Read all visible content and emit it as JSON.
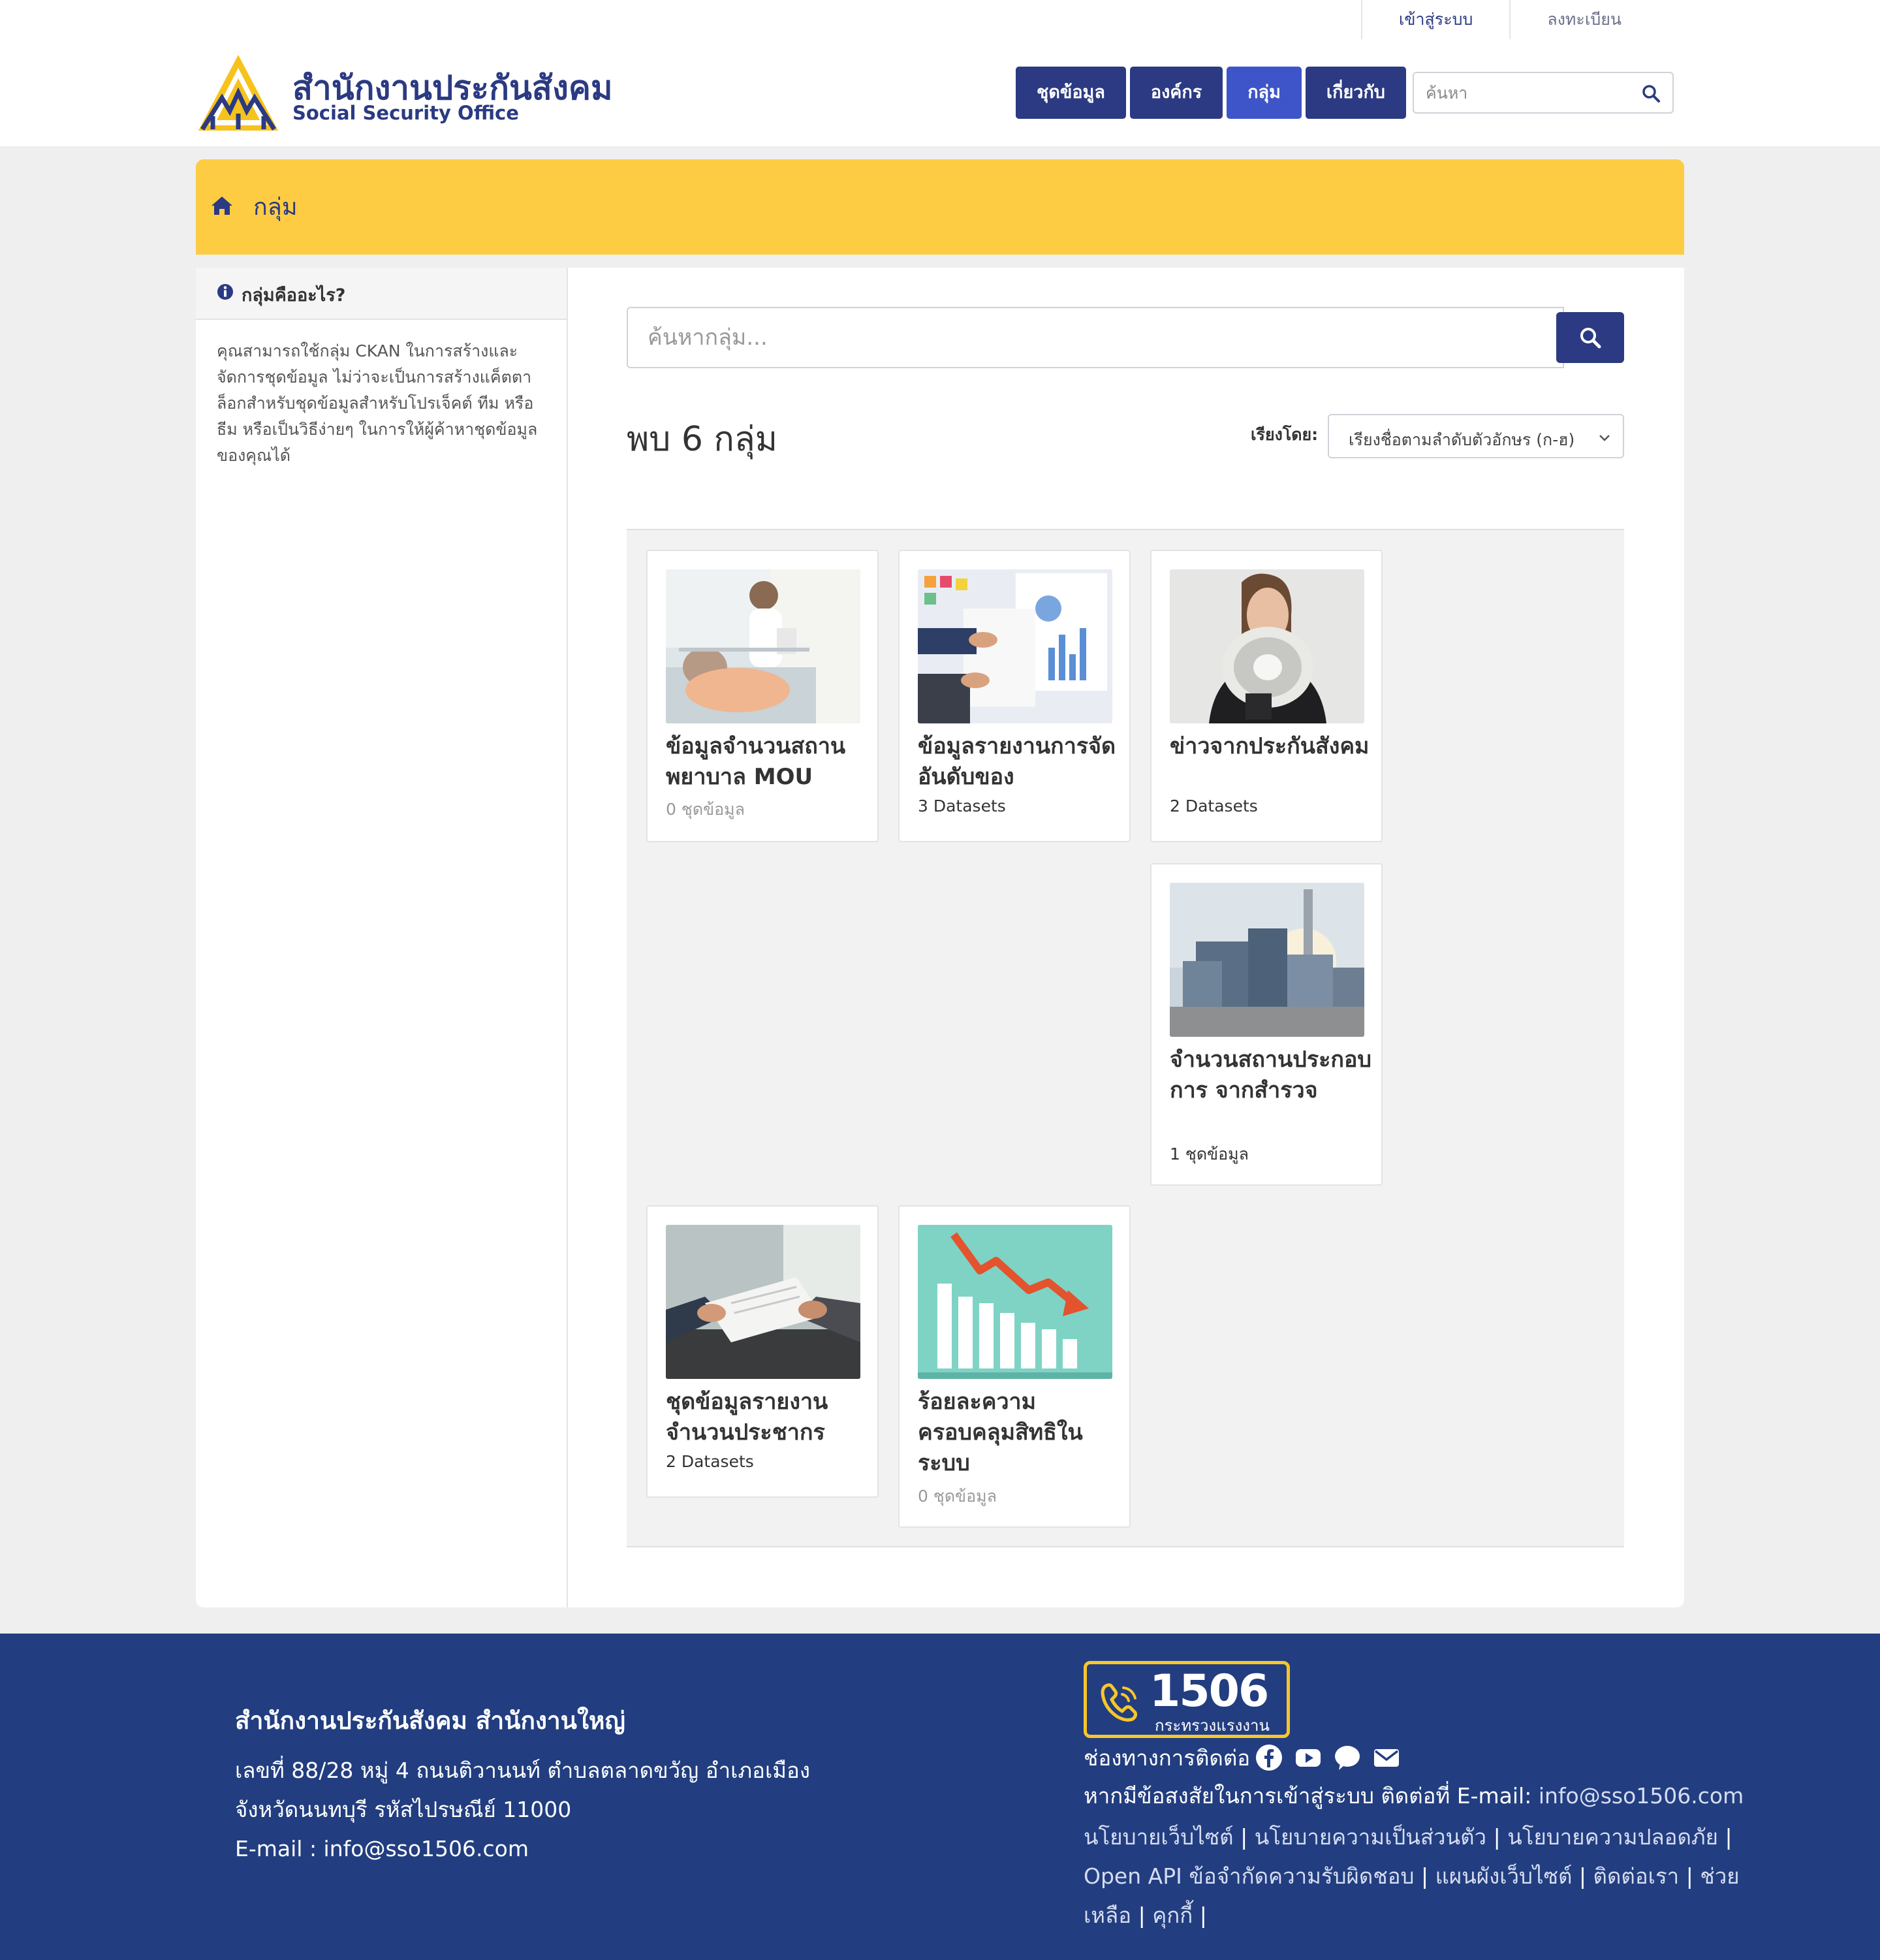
{
  "account": {
    "login": "เข้าสู่ระบบ",
    "register": "ลงทะเบียน"
  },
  "logo": {
    "th": "สำนักงานประกันสังคม",
    "en": "Social Security Office"
  },
  "nav": {
    "datasets": "ชุดข้อมูล",
    "organizations": "องค์กร",
    "groups": "กลุ่ม",
    "about": "เกี่ยวกับ"
  },
  "site_search": {
    "placeholder": "ค้นหา"
  },
  "breadcrumb": {
    "label": "กลุ่ม"
  },
  "aside": {
    "title": "กลุ่มคืออะไร?",
    "body": "คุณสามารถใช้กลุ่ม CKAN ในการสร้างและจัดการชุดข้อมูล ไม่ว่าจะเป็นการสร้างแค็ตตาล็อกสำหรับชุดข้อมูลสำหรับโปรเจ็คต์ ทีม หรือธีม หรือเป็นวิธีง่ายๆ ในการให้ผู้ค้าหาชุดข้อมูลของคุณได้"
  },
  "group_search": {
    "placeholder": "ค้นหากลุ่ม..."
  },
  "results": {
    "count_text": "พบ 6 กลุ่ม",
    "sort_label": "เรียงโดย:",
    "sort_value": "เรียงชื่อตามลำดับตัวอักษร (ก-ฮ)"
  },
  "groups": [
    {
      "name": "ข้อมูลจำนวนสถานพยาบาล MOU",
      "count": "0 ชุดข้อมูล",
      "image": "hospital-photo"
    },
    {
      "name": "ข้อมูลรายงานการจัดอันดับของ",
      "count": "3 Datasets",
      "image": "business-charts-photo"
    },
    {
      "name": "ข่าวจากประกันสังคม",
      "count": "2 Datasets",
      "image": "megaphone-photo"
    },
    {
      "name": "จำนวนสถานประกอบการ จากสำรวจ",
      "count": "1 ชุดข้อมูล",
      "image": "factory-photo"
    },
    {
      "name": "ชุดข้อมูลรายงานจำนวนประชากร",
      "count": "2 Datasets",
      "image": "handshake-document-photo"
    },
    {
      "name": "ร้อยละความครอบคลุมสิทธิในระบบ",
      "count": "0 ชุดข้อมูล",
      "image": "declining-chart-illustration"
    }
  ],
  "footer": {
    "title": "สำนักงานประกันสังคม สำนักงานใหญ่",
    "address_1": "เลขที่ 88/28 หมู่ 4 ถนนติวานนท์ ตำบลตลาดขวัญ อำเภอเมือง",
    "address_2": "จังหวัดนนทบุรี รหัสไปรษณีย์ 11000",
    "email_line": "E-mail : info@sso1506.com",
    "hotline_number": "1506",
    "hotline_sub": "กระทรวงแรงงาน",
    "channels_label": "ช่องทางการติดต่อ",
    "contact_text": "หากมีข้อสงสัยในการเข้าสู่ระบบ ติดต่อที่ E-mail: ",
    "contact_email": "info@sso1506.com",
    "links": {
      "website_policy": "นโยบายเว็บไซต์",
      "privacy_policy": "นโยบายความเป็นส่วนตัว",
      "security_policy": "นโยบายความปลอดภัย",
      "open_api": "Open API",
      "disclaimer": "ข้อจำกัดความรับผิดชอบ",
      "sitemap": "แผนผังเว็บไซต์",
      "contact": "ติดต่อเรา",
      "help": "ช่วยเหลือ",
      "cookies": "คุกกี้"
    }
  },
  "colors": {
    "primary": "#2b3a82",
    "nav_active": "#3d55c8",
    "breadcrumb": "#fdcc43",
    "footer": "#223e80",
    "hotline_border": "#f7c629"
  },
  "icons": [
    "home-icon",
    "info-icon",
    "search-icon",
    "chevron-down-icon",
    "phone-icon",
    "facebook-icon",
    "youtube-icon",
    "line-chat-icon",
    "email-icon"
  ]
}
